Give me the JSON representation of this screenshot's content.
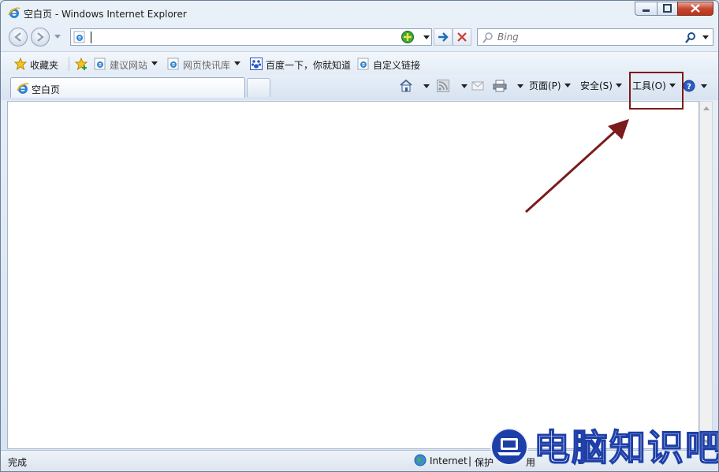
{
  "window": {
    "title": "空白页 - Windows Internet Explorer"
  },
  "address_bar": {
    "value": "",
    "compat_icon": "compatibility-view-icon"
  },
  "search": {
    "placeholder": "Bing"
  },
  "favorites_bar": {
    "favorites_label": "收藏夹",
    "items": [
      {
        "label": "建议网站",
        "icon": "ie-page-icon",
        "dropdown": true
      },
      {
        "label": "网页快讯库",
        "icon": "ie-page-icon",
        "dropdown": true
      },
      {
        "label": "百度一下，你就知道",
        "icon": "baidu-paw-icon",
        "dropdown": false
      },
      {
        "label": "自定义链接",
        "icon": "ie-page-icon",
        "dropdown": false
      }
    ]
  },
  "tab": {
    "label": "空白页"
  },
  "command_bar": {
    "page_label": "页面(P)",
    "safety_label": "安全(S)",
    "tools_label": "工具(O)",
    "icons": [
      "home-icon",
      "rss-feed-icon",
      "read-mail-icon",
      "print-icon",
      "help-icon"
    ]
  },
  "status_bar": {
    "text": "完成",
    "zone": "Internet",
    "separator": "|",
    "protected_mode": "保护",
    "protected_mode_tail": "用"
  },
  "watermark": {
    "text": "电脑知识吧"
  },
  "colors": {
    "highlight": "#7c1b1b",
    "close_button": "#c5482f",
    "ie_blue": "#1d6fc4",
    "compat_green": "#3aa83a"
  }
}
